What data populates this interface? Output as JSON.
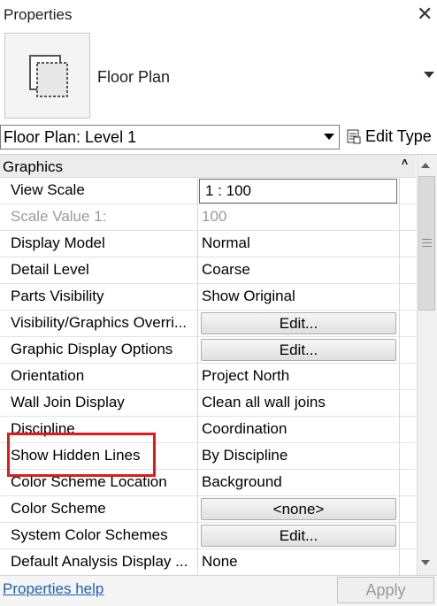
{
  "title": "Properties",
  "close_glyph": "✕",
  "type": {
    "name": "Floor Plan",
    "icon": "floor-plan-icon"
  },
  "selector": {
    "value": "Floor Plan: Level 1",
    "edit_type_label": "Edit Type"
  },
  "group": {
    "label": "Graphics",
    "collapse_glyph": "˄"
  },
  "rows": [
    {
      "name": "View Scale",
      "value": "1 : 100",
      "kind": "input"
    },
    {
      "name": "Scale Value    1:",
      "value": "100",
      "kind": "disabled"
    },
    {
      "name": "Display Model",
      "value": "Normal",
      "kind": "text"
    },
    {
      "name": "Detail Level",
      "value": "Coarse",
      "kind": "text"
    },
    {
      "name": "Parts Visibility",
      "value": "Show Original",
      "kind": "text"
    },
    {
      "name": "Visibility/Graphics Overri...",
      "value": "Edit...",
      "kind": "button"
    },
    {
      "name": "Graphic Display Options",
      "value": "Edit...",
      "kind": "button"
    },
    {
      "name": "Orientation",
      "value": "Project North",
      "kind": "text"
    },
    {
      "name": "Wall Join Display",
      "value": "Clean all wall joins",
      "kind": "text"
    },
    {
      "name": "Discipline",
      "value": "Coordination",
      "kind": "text"
    },
    {
      "name": "Show Hidden Lines",
      "value": "By Discipline",
      "kind": "text"
    },
    {
      "name": "Color Scheme Location",
      "value": "Background",
      "kind": "text"
    },
    {
      "name": "Color Scheme",
      "value": "<none>",
      "kind": "button"
    },
    {
      "name": "System Color Schemes",
      "value": "Edit...",
      "kind": "button"
    },
    {
      "name": "Default Analysis Display ...",
      "value": "None",
      "kind": "text"
    }
  ],
  "footer": {
    "help_label": "Properties help",
    "apply_label": "Apply"
  },
  "colors": {
    "highlight": "#e11b1b",
    "link": "#1a5fb4"
  }
}
